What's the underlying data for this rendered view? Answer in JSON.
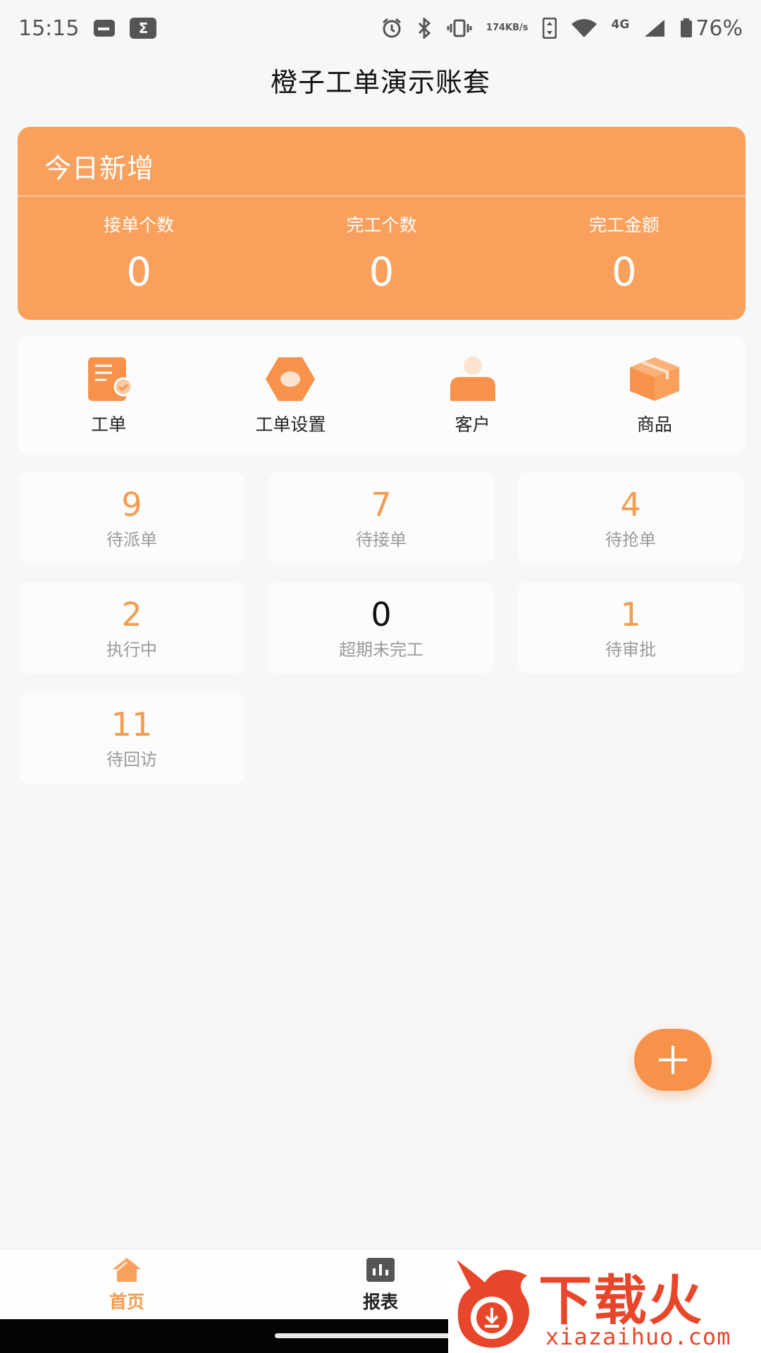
{
  "status_bar": {
    "time": "15:15",
    "net_speed_value": "174",
    "net_speed_unit": "KB/s",
    "network": "4G",
    "battery": "76%"
  },
  "header": {
    "title": "橙子工单演示账套"
  },
  "today": {
    "title": "今日新增",
    "stats": [
      {
        "label": "接单个数",
        "value": "0"
      },
      {
        "label": "完工个数",
        "value": "0"
      },
      {
        "label": "完工金额",
        "value": "0"
      }
    ]
  },
  "menu": [
    {
      "label": "工单",
      "icon": "work-order-icon"
    },
    {
      "label": "工单设置",
      "icon": "work-order-settings-icon"
    },
    {
      "label": "客户",
      "icon": "customer-icon"
    },
    {
      "label": "商品",
      "icon": "product-box-icon"
    }
  ],
  "tiles": [
    {
      "value": "9",
      "label": "待派单"
    },
    {
      "value": "7",
      "label": "待接单"
    },
    {
      "value": "4",
      "label": "待抢单"
    },
    {
      "value": "2",
      "label": "执行中"
    },
    {
      "value": "0",
      "label": "超期未完工"
    },
    {
      "value": "1",
      "label": "待审批"
    },
    {
      "value": "11",
      "label": "待回访"
    }
  ],
  "nav": {
    "home_label": "首页",
    "report_label": "报表"
  },
  "watermark": {
    "text": "下载火",
    "url": "xiazaihuo.com"
  },
  "colors": {
    "accent": "#f9a05c",
    "tile_value": "#f39c4e",
    "background": "#f7f7f7"
  }
}
